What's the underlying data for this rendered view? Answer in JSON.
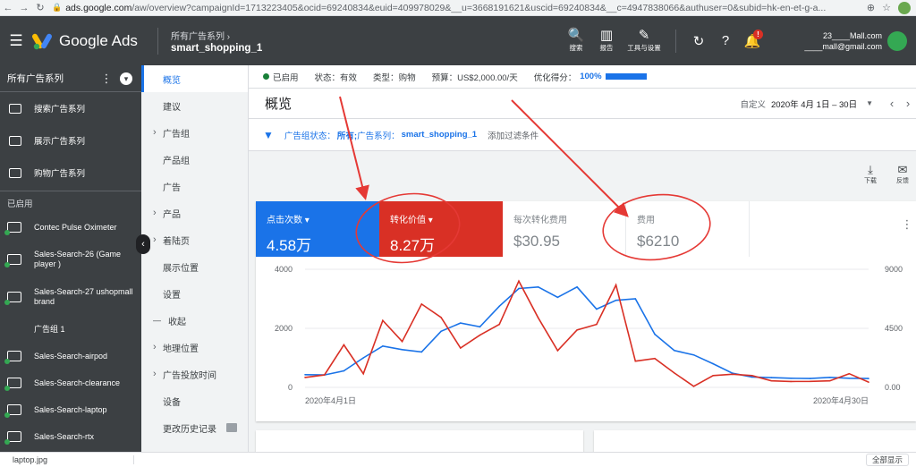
{
  "browser": {
    "url_host": "ads.google.com",
    "url_path": "/aw/overview?campaignId=1713223405&ocid=69240834&euid=409978029&__u=3668191621&uscid=69240834&__c=4947838066&authuser=0&subid=hk-en-et-g-a..."
  },
  "header": {
    "logo_text": "Google Ads",
    "breadcrumb_parent": "所有广告系列 ›",
    "breadcrumb_current": "smart_shopping_1",
    "tools": [
      {
        "icon": "search-icon",
        "label": "搜索"
      },
      {
        "icon": "report-icon",
        "label": "报告"
      },
      {
        "icon": "wrench-icon",
        "label": "工具与设置"
      }
    ],
    "notification_count": "!",
    "account_line1": "23____Mall.com",
    "account_line2": "____mall@gmail.com"
  },
  "sidebar": {
    "title": "所有广告系列",
    "types": [
      {
        "label": "搜索广告系列",
        "icon": "search-campaign-icon"
      },
      {
        "label": "展示广告系列",
        "icon": "display-campaign-icon"
      },
      {
        "label": "购物广告系列",
        "icon": "shopping-campaign-icon"
      }
    ],
    "enabled_section": "已启用",
    "campaigns": [
      {
        "label": "Contec Pulse Oximeter",
        "icon": true,
        "tall": false
      },
      {
        "label": "Sales-Search-26 (Game player )",
        "icon": true,
        "tall": true
      },
      {
        "label": "Sales-Search-27 ushopmall brand",
        "icon": true,
        "tall": true
      },
      {
        "label": "广告组 1",
        "icon": false,
        "tall": false
      },
      {
        "label": "Sales-Search-airpod",
        "icon": true,
        "tall": false
      },
      {
        "label": "Sales-Search-clearance",
        "icon": true,
        "tall": false
      },
      {
        "label": "Sales-Search-laptop",
        "icon": true,
        "tall": false
      },
      {
        "label": "Sales-Search-rtx",
        "icon": true,
        "tall": false
      }
    ]
  },
  "nav": {
    "items": [
      {
        "label": "概览",
        "kind": "sel"
      },
      {
        "label": "建议",
        "kind": ""
      },
      {
        "label": "广告组",
        "kind": "exp"
      },
      {
        "label": "产品组",
        "kind": ""
      },
      {
        "label": "广告",
        "kind": ""
      },
      {
        "label": "产品",
        "kind": "exp"
      },
      {
        "label": "着陆页",
        "kind": "exp"
      },
      {
        "label": "展示位置",
        "kind": ""
      },
      {
        "label": "设置",
        "kind": ""
      },
      {
        "label": "收起",
        "kind": "col"
      },
      {
        "label": "地理位置",
        "kind": "exp"
      },
      {
        "label": "广告投放时间",
        "kind": "exp"
      },
      {
        "label": "设备",
        "kind": ""
      },
      {
        "label": "更改历史记录",
        "kind": "fb"
      }
    ]
  },
  "status": {
    "enabled": "已启用",
    "state_label": "状态：",
    "state_value": "有效",
    "type_label": "类型：",
    "type_value": "购物",
    "budget_label": "预算：",
    "budget_value": "US$2,000.00/天",
    "score_label": "优化得分：",
    "score_value": "100%",
    "score_fraction": 1.0
  },
  "page": {
    "title": "概览",
    "date_label": "自定义",
    "date_range": "2020年 4月 1日 – 30日"
  },
  "filter": {
    "label": "广告组状态：",
    "value1": "所有;",
    "label2": " 广告系列：",
    "value2": "smart_shopping_1",
    "add": "添加过滤条件"
  },
  "actions": [
    {
      "icon": "download-icon",
      "label": "下载"
    },
    {
      "icon": "feedback-icon",
      "label": "反馈"
    }
  ],
  "metrics": [
    {
      "label": "点击次数 ▾",
      "value": "4.58万",
      "style": "blue"
    },
    {
      "label": "转化价值 ▾",
      "value": "8.27万",
      "style": "red"
    },
    {
      "label": "每次转化费用",
      "value": "$30.95",
      "style": "plain"
    },
    {
      "label": "费用",
      "value": "$6210",
      "style": "plain"
    }
  ],
  "chart_data": {
    "type": "line",
    "x_start_label": "2020年4月1日",
    "x_end_label": "2020年4月30日",
    "y_left_ticks": [
      "4000",
      "2000",
      "0"
    ],
    "y_right_ticks": [
      "9000",
      "4500",
      "0.00"
    ],
    "y_left_range": [
      0,
      4000
    ],
    "y_right_range": [
      0,
      9000
    ],
    "grid": true,
    "colors": {
      "clicks": "#1a73e8",
      "conversion_value": "#d93025"
    },
    "series": [
      {
        "key": "clicks",
        "axis": "left",
        "values": [
          430,
          420,
          560,
          1000,
          1400,
          1280,
          1200,
          1900,
          2180,
          2050,
          2750,
          3350,
          3400,
          3050,
          3400,
          2650,
          2950,
          3000,
          1800,
          1250,
          1100,
          800,
          480,
          350,
          330,
          310,
          300,
          340,
          310,
          300
        ]
      },
      {
        "key": "conversion_value",
        "axis": "right",
        "values": [
          760,
          950,
          3240,
          1040,
          5100,
          3500,
          6350,
          5330,
          3000,
          3980,
          4800,
          8100,
          5300,
          2800,
          4380,
          4800,
          7800,
          2000,
          2200,
          1100,
          80,
          900,
          1000,
          900,
          500,
          450,
          460,
          500,
          1040,
          400
        ]
      }
    ]
  },
  "downloads": {
    "file": "laptop.jpg",
    "show_all": "全部显示"
  }
}
